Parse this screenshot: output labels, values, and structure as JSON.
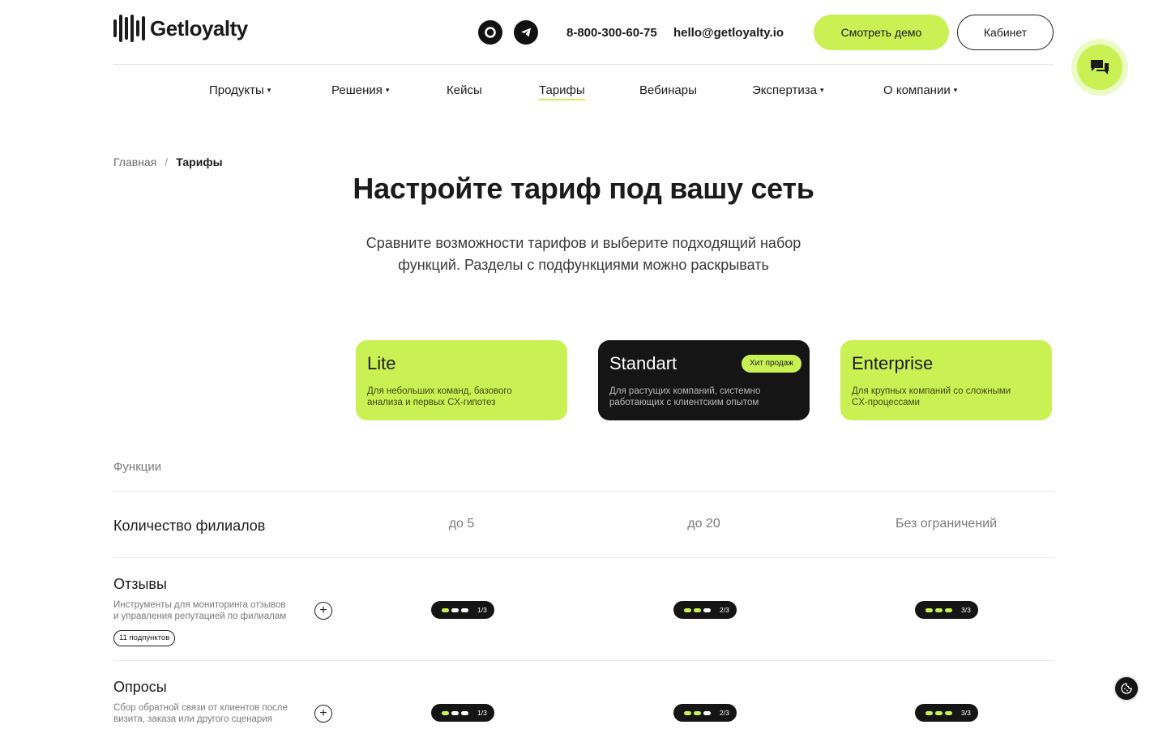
{
  "header": {
    "logo_text": "Getloyalty",
    "phone": "8-800-300-60-75",
    "email": "hello@getloyalty.io",
    "demo_button": "Смотреть демо",
    "cabinet_button": "Кабинет"
  },
  "nav": {
    "items": [
      {
        "label": "Продукты",
        "caret": "▾"
      },
      {
        "label": "Решения",
        "caret": "▾"
      },
      {
        "label": "Кейсы"
      },
      {
        "label": "Тарифы"
      },
      {
        "label": "Вебинары"
      },
      {
        "label": "Экспертиза",
        "caret": "▾"
      },
      {
        "label": "О компании",
        "caret": "▾"
      }
    ]
  },
  "breadcrumb": {
    "home": "Главная",
    "sep": "/",
    "current": "Тарифы"
  },
  "hero": {
    "title": "Настройте тариф под вашу сеть",
    "subtitle_line1": "Сравните возможности тарифов и выберите подходящий набор",
    "subtitle_line2": "функций. Разделы с подфункциями можно раскрывать"
  },
  "plans": [
    {
      "name": "Lite",
      "desc_line1": "Для небольших команд, базового",
      "desc_line2": "анализа и первых CX-гипотез"
    },
    {
      "name": "Standart",
      "badge": "Хит продаж",
      "desc_line1": "Для растущих компаний, системно",
      "desc_line2": "работающих с клиентским опытом"
    },
    {
      "name": "Enterprise",
      "desc_line1": "Для крупных компаний со сложными",
      "desc_line2": "CX-процессами"
    }
  ],
  "table": {
    "functions_label": "Функции",
    "branches": {
      "title": "Количество филиалов",
      "values": [
        "до 5",
        "до 20",
        "Без ограничений"
      ]
    },
    "reviews": {
      "title": "Отзывы",
      "desc_line1": "Инструменты для мониторинга отзывов",
      "desc_line2": "и управления репутацией по филиалам",
      "subcount": "11 подпунктов",
      "levels": [
        {
          "label": "1/3",
          "value": 1
        },
        {
          "label": "2/3",
          "value": 2
        },
        {
          "label": "3/3",
          "value": 3
        }
      ]
    },
    "surveys": {
      "title": "Опросы",
      "desc_line1": "Сбор обратной связи от клиентов после",
      "desc_line2": "визита, заказа или другого сценария",
      "levels": [
        {
          "label": "1/3",
          "value": 1
        },
        {
          "label": "2/3",
          "value": 2
        },
        {
          "label": "3/3",
          "value": 3
        }
      ]
    }
  },
  "colors": {
    "accent": "#c9f153",
    "dark": "#151515"
  }
}
